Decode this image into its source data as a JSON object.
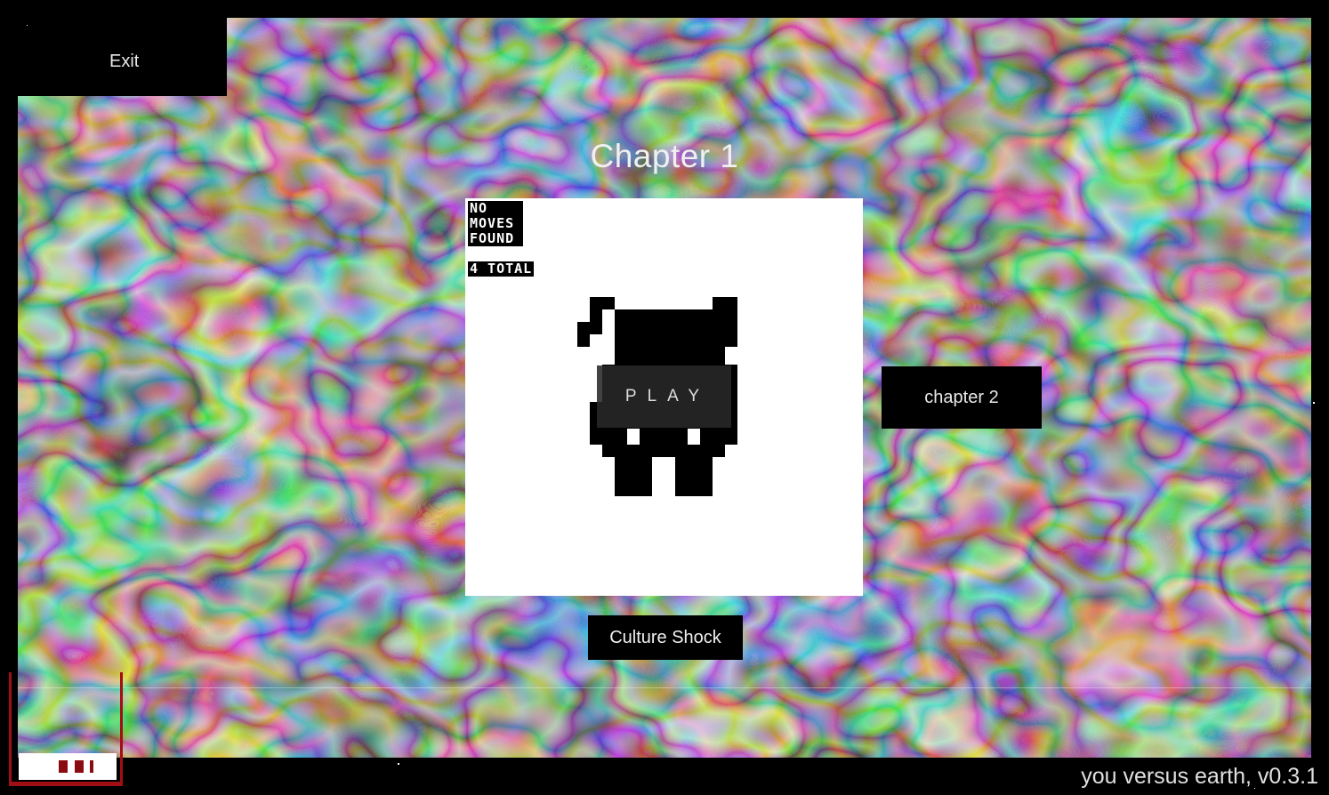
{
  "menu": {
    "exit_label": "Exit"
  },
  "chapter": {
    "title": "Chapter 1",
    "next_label": "chapter 2"
  },
  "level": {
    "stamp_lines": [
      "no",
      "moves",
      "found"
    ],
    "total_label": "4 total",
    "play_label": "PLAY",
    "name": "Culture Shock"
  },
  "footer": {
    "version": "you versus earth, v0.3.1"
  },
  "colors": {
    "background": "#000000",
    "accent": "#a10e14",
    "card": "#ffffff"
  }
}
